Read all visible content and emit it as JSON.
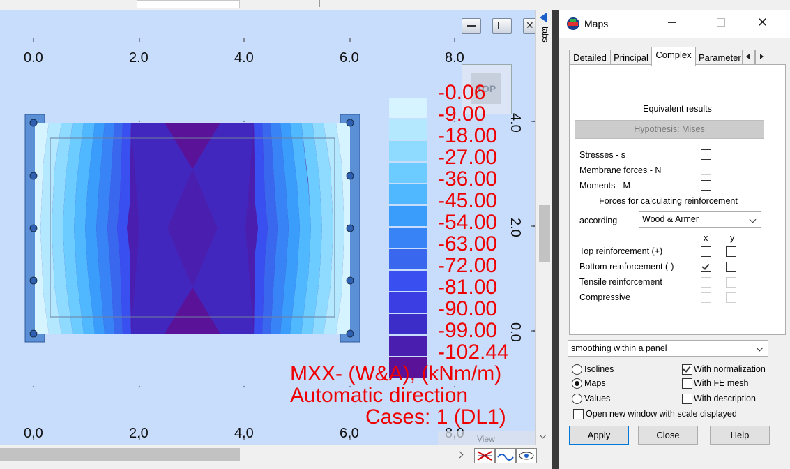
{
  "viewport": {
    "ruler_top": [
      "0.0",
      "2.0",
      "4.0",
      "6.0",
      "8.0"
    ],
    "ruler_bottom": [
      "0.0",
      "2.0",
      "4.0",
      "6.0",
      "8.0"
    ],
    "ruler_right": [
      "4.0",
      "2.0",
      "0.0"
    ],
    "view_cube_label": "TOP",
    "view_label": "View",
    "legend": {
      "values": [
        "-0.06",
        "-9.00",
        "-18.00",
        "-27.00",
        "-36.00",
        "-45.00",
        "-54.00",
        "-63.00",
        "-72.00",
        "-81.00",
        "-90.00",
        "-99.00",
        "-102.44"
      ],
      "colors": [
        "#d6f4ff",
        "#b4e8ff",
        "#8fdaff",
        "#6ccbff",
        "#4fb8ff",
        "#3a9dfb",
        "#3883f5",
        "#3968ef",
        "#3a4ff0",
        "#3b3ee2",
        "#3d2dc8",
        "#4a1fb0",
        "#5a1299"
      ]
    },
    "caption": {
      "line1": "MXX- (W&A), (kNm/m)",
      "line2": "Automatic direction",
      "line3": "Cases: 1 (DL1)"
    }
  },
  "side_tabs_label": "tabs",
  "dialog": {
    "title": "Maps",
    "tabs": [
      "Detailed",
      "Principal",
      "Complex",
      "Parameter"
    ],
    "active_tab": "Complex",
    "equivalent_results": "Equivalent results",
    "hypothesis_button": "Hypothesis: Mises",
    "rows": {
      "stresses": "Stresses - s",
      "membrane": "Membrane forces - N",
      "moments": "Moments - M"
    },
    "forces_heading": "Forces for calculating reinforcement",
    "according_label": "according",
    "according_value": "Wood & Armer",
    "col_x": "x",
    "col_y": "y",
    "reinf": {
      "top": "Top reinforcement (+)",
      "bottom": "Bottom reinforcement (-)",
      "tensile": "Tensile reinforcement",
      "compressive": "Compressive"
    },
    "smoothing_value": "smoothing within a panel",
    "options": {
      "isolines": "Isolines",
      "maps": "Maps",
      "values": "Values",
      "normalization": "With normalization",
      "fe_mesh": "With FE mesh",
      "description": "With description",
      "open_new": "Open new window with scale displayed"
    },
    "buttons": {
      "apply": "Apply",
      "close": "Close",
      "help": "Help"
    }
  }
}
